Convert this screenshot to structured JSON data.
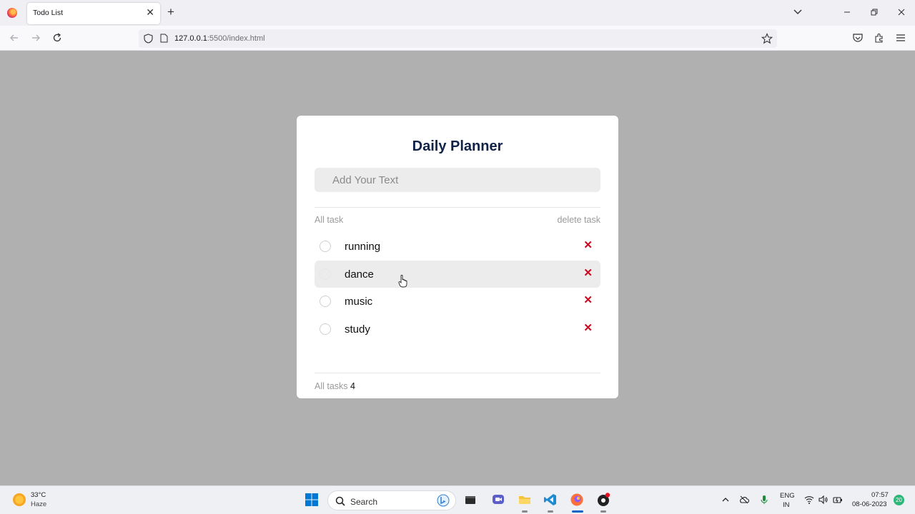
{
  "browser": {
    "tab": {
      "title": "Todo List",
      "close_glyph": "✕"
    },
    "new_tab_glyph": "+",
    "url": {
      "host": "127.0.0.1",
      "rest": ":5500/index.html"
    },
    "icons": [
      "firefox-icon",
      "list-all-tabs-icon",
      "minimize-icon",
      "restore-icon",
      "close-window-icon",
      "back-icon",
      "forward-icon",
      "reload-icon",
      "shield-icon",
      "page-icon",
      "bookmark-star-icon",
      "pocket-icon",
      "extensions-icon",
      "menu-icon"
    ]
  },
  "app": {
    "title": "Daily Planner",
    "input": {
      "placeholder": "Add Your Text",
      "value": ""
    },
    "list_header": {
      "left": "All task",
      "right": "delete task"
    },
    "tasks": [
      {
        "text": "running",
        "delete_glyph": "✕",
        "hovered": false
      },
      {
        "text": "dance",
        "delete_glyph": "✕",
        "hovered": true
      },
      {
        "text": "music",
        "delete_glyph": "✕",
        "hovered": false
      },
      {
        "text": "study",
        "delete_glyph": "✕",
        "hovered": false
      }
    ],
    "footer": {
      "label": "All tasks",
      "count": "4"
    },
    "colors": {
      "title": "#102347",
      "delete": "#d0021b",
      "backdrop": "#b0b0b0"
    }
  },
  "taskbar": {
    "weather": {
      "temp": "33°C",
      "condition": "Haze"
    },
    "search": {
      "placeholder": "Search"
    },
    "language": {
      "line1": "ENG",
      "line2": "IN"
    },
    "clock": {
      "time": "07:57",
      "date": "08-06-2023"
    },
    "notifications": "20",
    "icons": [
      "windows-start-icon",
      "search-icon",
      "bing-icon",
      "file-manager-icon",
      "teams-icon",
      "file-explorer-icon",
      "vscode-icon",
      "firefox-icon",
      "obs-icon",
      "chevron-up-icon",
      "onedrive-icon",
      "microphone-icon",
      "wifi-icon",
      "volume-icon",
      "battery-icon"
    ]
  }
}
